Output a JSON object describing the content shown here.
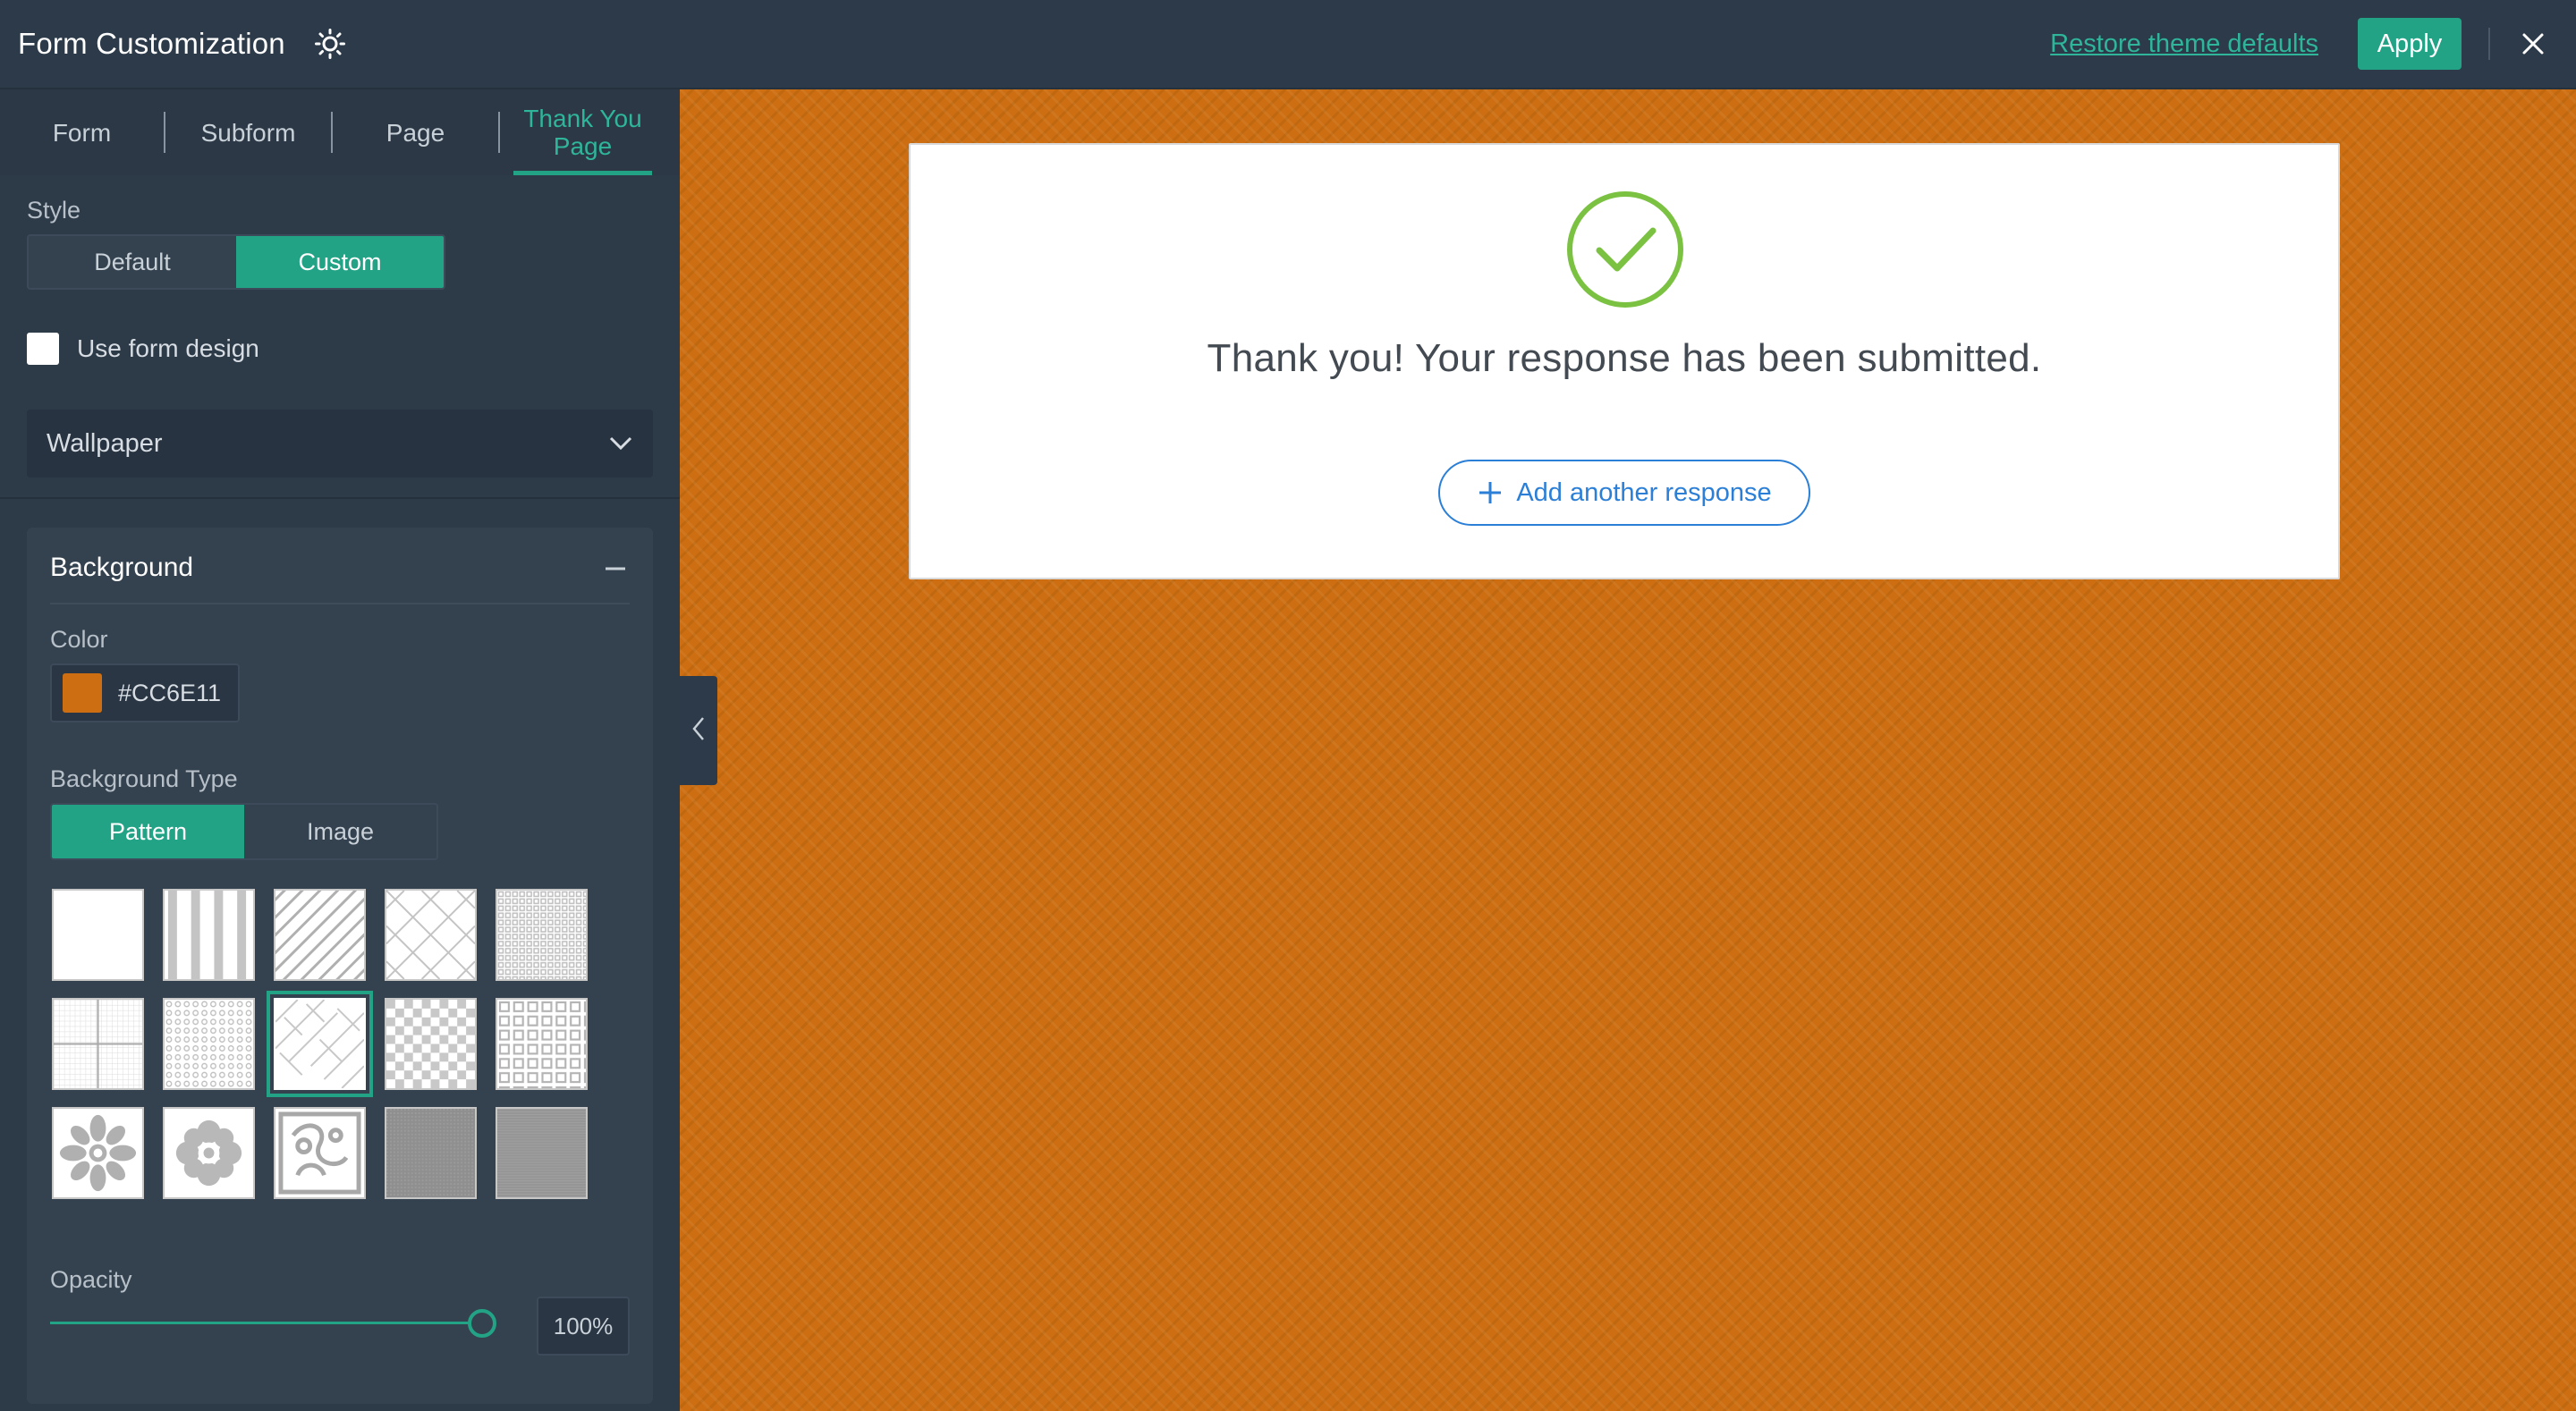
{
  "header": {
    "title": "Form Customization",
    "restore_label": "Restore theme defaults",
    "apply_label": "Apply"
  },
  "tabs": [
    {
      "label": "Form"
    },
    {
      "label": "Subform"
    },
    {
      "label": "Page"
    },
    {
      "label": "Thank You Page",
      "active": true
    }
  ],
  "style": {
    "label": "Style",
    "options": [
      "Default",
      "Custom"
    ],
    "selected": "Custom"
  },
  "use_form_design": {
    "label": "Use form design",
    "checked": false
  },
  "wallpaper_select": {
    "value": "Wallpaper"
  },
  "background": {
    "title": "Background",
    "color_label": "Color",
    "color_value": "#CC6E11",
    "type_label": "Background Type",
    "type_options": [
      "Pattern",
      "Image"
    ],
    "type_selected": "Pattern",
    "patterns": [
      "plain-white",
      "vertical-stripes",
      "diagonal-lines",
      "diamond-lattice",
      "fine-grid",
      "large-grid",
      "dot-grid",
      "herringbone",
      "checkerboard",
      "square-dots",
      "flower-ornament",
      "daisy-ornament",
      "scroll-ornament",
      "gray-linen",
      "gray-texture"
    ],
    "selected_pattern": "herringbone",
    "opacity_label": "Opacity",
    "opacity_value": "100%",
    "opacity_level": 1.0
  },
  "preview": {
    "thank_you_message": "Thank you! Your response has been submitted.",
    "add_response_label": "Add another response"
  },
  "colors": {
    "accent": "#23a386",
    "panel_bg": "#2d3a48",
    "preview_bg": "#cc6e11",
    "link": "#2b7fd6",
    "check": "#7cc242"
  }
}
